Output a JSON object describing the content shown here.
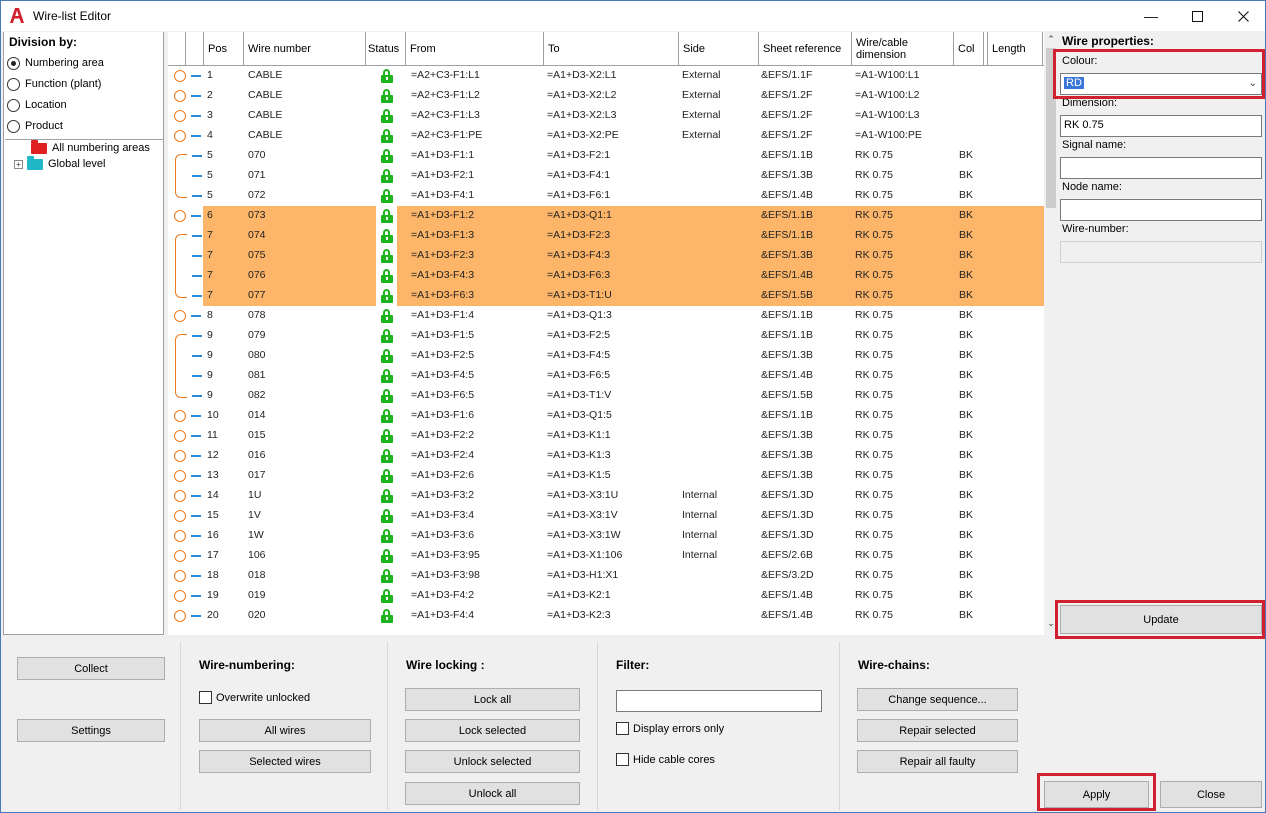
{
  "window": {
    "title": "Wire-list Editor"
  },
  "division": {
    "title": "Division by:",
    "options": [
      "Numbering area",
      "Function (plant)",
      "Location",
      "Product"
    ],
    "selected": 0,
    "tree": [
      {
        "label": "All numbering areas",
        "color": "#e02020"
      },
      {
        "label": "Global level",
        "color": "#20b8c8"
      }
    ]
  },
  "columns": [
    "Pos",
    "Wire number",
    "Status",
    "From",
    "To",
    "Side",
    "Sheet reference",
    "Wire/cable dimension",
    "Col",
    "Length"
  ],
  "rows": [
    {
      "pos": "1",
      "wire": "CABLE",
      "from": "=A2+C3-F1:L1",
      "to": "=A1+D3-X2:L1",
      "side": "External",
      "sheet": "&EFS/1.1F",
      "dim": "=A1-W100:L1",
      "col": "",
      "marker": "circle",
      "sel": false
    },
    {
      "pos": "2",
      "wire": "CABLE",
      "from": "=A2+C3-F1:L2",
      "to": "=A1+D3-X2:L2",
      "side": "External",
      "sheet": "&EFS/1.2F",
      "dim": "=A1-W100:L2",
      "col": "",
      "marker": "circle",
      "sel": false
    },
    {
      "pos": "3",
      "wire": "CABLE",
      "from": "=A2+C3-F1:L3",
      "to": "=A1+D3-X2:L3",
      "side": "External",
      "sheet": "&EFS/1.2F",
      "dim": "=A1-W100:L3",
      "col": "",
      "marker": "circle",
      "sel": false
    },
    {
      "pos": "4",
      "wire": "CABLE",
      "from": "=A2+C3-F1:PE",
      "to": "=A1+D3-X2:PE",
      "side": "External",
      "sheet": "&EFS/1.2F",
      "dim": "=A1-W100:PE",
      "col": "",
      "marker": "circle",
      "sel": false
    },
    {
      "pos": "5",
      "wire": "070",
      "from": "=A1+D3-F1:1",
      "to": "=A1+D3-F2:1",
      "side": "",
      "sheet": "&EFS/1.1B",
      "dim": "RK 0.75",
      "col": "BK",
      "marker": "chain",
      "sel": false
    },
    {
      "pos": "5",
      "wire": "071",
      "from": "=A1+D3-F2:1",
      "to": "=A1+D3-F4:1",
      "side": "",
      "sheet": "&EFS/1.3B",
      "dim": "RK 0.75",
      "col": "BK",
      "marker": "chain",
      "sel": false
    },
    {
      "pos": "5",
      "wire": "072",
      "from": "=A1+D3-F4:1",
      "to": "=A1+D3-F6:1",
      "side": "",
      "sheet": "&EFS/1.4B",
      "dim": "RK 0.75",
      "col": "BK",
      "marker": "chain",
      "sel": false
    },
    {
      "pos": "6",
      "wire": "073",
      "from": "=A1+D3-F1:2",
      "to": "=A1+D3-Q1:1",
      "side": "",
      "sheet": "&EFS/1.1B",
      "dim": "RK 0.75",
      "col": "BK",
      "marker": "circle",
      "sel": true
    },
    {
      "pos": "7",
      "wire": "074",
      "from": "=A1+D3-F1:3",
      "to": "=A1+D3-F2:3",
      "side": "",
      "sheet": "&EFS/1.1B",
      "dim": "RK 0.75",
      "col": "BK",
      "marker": "chain",
      "sel": true
    },
    {
      "pos": "7",
      "wire": "075",
      "from": "=A1+D3-F2:3",
      "to": "=A1+D3-F4:3",
      "side": "",
      "sheet": "&EFS/1.3B",
      "dim": "RK 0.75",
      "col": "BK",
      "marker": "chain",
      "sel": true
    },
    {
      "pos": "7",
      "wire": "076",
      "from": "=A1+D3-F4:3",
      "to": "=A1+D3-F6:3",
      "side": "",
      "sheet": "&EFS/1.4B",
      "dim": "RK 0.75",
      "col": "BK",
      "marker": "chain",
      "sel": true
    },
    {
      "pos": "7",
      "wire": "077",
      "from": "=A1+D3-F6:3",
      "to": "=A1+D3-T1:U",
      "side": "",
      "sheet": "&EFS/1.5B",
      "dim": "RK 0.75",
      "col": "BK",
      "marker": "chain",
      "sel": true
    },
    {
      "pos": "8",
      "wire": "078",
      "from": "=A1+D3-F1:4",
      "to": "=A1+D3-Q1:3",
      "side": "",
      "sheet": "&EFS/1.1B",
      "dim": "RK 0.75",
      "col": "BK",
      "marker": "circle",
      "sel": false
    },
    {
      "pos": "9",
      "wire": "079",
      "from": "=A1+D3-F1:5",
      "to": "=A1+D3-F2:5",
      "side": "",
      "sheet": "&EFS/1.1B",
      "dim": "RK 0.75",
      "col": "BK",
      "marker": "chain",
      "sel": false
    },
    {
      "pos": "9",
      "wire": "080",
      "from": "=A1+D3-F2:5",
      "to": "=A1+D3-F4:5",
      "side": "",
      "sheet": "&EFS/1.3B",
      "dim": "RK 0.75",
      "col": "BK",
      "marker": "chain",
      "sel": false
    },
    {
      "pos": "9",
      "wire": "081",
      "from": "=A1+D3-F4:5",
      "to": "=A1+D3-F6:5",
      "side": "",
      "sheet": "&EFS/1.4B",
      "dim": "RK 0.75",
      "col": "BK",
      "marker": "chain",
      "sel": false
    },
    {
      "pos": "9",
      "wire": "082",
      "from": "=A1+D3-F6:5",
      "to": "=A1+D3-T1:V",
      "side": "",
      "sheet": "&EFS/1.5B",
      "dim": "RK 0.75",
      "col": "BK",
      "marker": "chain",
      "sel": false
    },
    {
      "pos": "10",
      "wire": "014",
      "from": "=A1+D3-F1:6",
      "to": "=A1+D3-Q1:5",
      "side": "",
      "sheet": "&EFS/1.1B",
      "dim": "RK 0.75",
      "col": "BK",
      "marker": "circle",
      "sel": false
    },
    {
      "pos": "11",
      "wire": "015",
      "from": "=A1+D3-F2:2",
      "to": "=A1+D3-K1:1",
      "side": "",
      "sheet": "&EFS/1.3B",
      "dim": "RK 0.75",
      "col": "BK",
      "marker": "circle",
      "sel": false
    },
    {
      "pos": "12",
      "wire": "016",
      "from": "=A1+D3-F2:4",
      "to": "=A1+D3-K1:3",
      "side": "",
      "sheet": "&EFS/1.3B",
      "dim": "RK 0.75",
      "col": "BK",
      "marker": "circle",
      "sel": false
    },
    {
      "pos": "13",
      "wire": "017",
      "from": "=A1+D3-F2:6",
      "to": "=A1+D3-K1:5",
      "side": "",
      "sheet": "&EFS/1.3B",
      "dim": "RK 0.75",
      "col": "BK",
      "marker": "circle",
      "sel": false
    },
    {
      "pos": "14",
      "wire": "1U",
      "from": "=A1+D3-F3:2",
      "to": "=A1+D3-X3:1U",
      "side": "Internal",
      "sheet": "&EFS/1.3D",
      "dim": "RK 0.75",
      "col": "BK",
      "marker": "circle",
      "sel": false
    },
    {
      "pos": "15",
      "wire": "1V",
      "from": "=A1+D3-F3:4",
      "to": "=A1+D3-X3:1V",
      "side": "Internal",
      "sheet": "&EFS/1.3D",
      "dim": "RK 0.75",
      "col": "BK",
      "marker": "circle",
      "sel": false
    },
    {
      "pos": "16",
      "wire": "1W",
      "from": "=A1+D3-F3:6",
      "to": "=A1+D3-X3:1W",
      "side": "Internal",
      "sheet": "&EFS/1.3D",
      "dim": "RK 0.75",
      "col": "BK",
      "marker": "circle",
      "sel": false
    },
    {
      "pos": "17",
      "wire": "106",
      "from": "=A1+D3-F3:95",
      "to": "=A1+D3-X1:106",
      "side": "Internal",
      "sheet": "&EFS/2.6B",
      "dim": "RK 0.75",
      "col": "BK",
      "marker": "circle",
      "sel": false
    },
    {
      "pos": "18",
      "wire": "018",
      "from": "=A1+D3-F3:98",
      "to": "=A1+D3-H1:X1",
      "side": "",
      "sheet": "&EFS/3.2D",
      "dim": "RK 0.75",
      "col": "BK",
      "marker": "circle",
      "sel": false
    },
    {
      "pos": "19",
      "wire": "019",
      "from": "=A1+D3-F4:2",
      "to": "=A1+D3-K2:1",
      "side": "",
      "sheet": "&EFS/1.4B",
      "dim": "RK 0.75",
      "col": "BK",
      "marker": "circle",
      "sel": false
    },
    {
      "pos": "20",
      "wire": "020",
      "from": "=A1+D3-F4:4",
      "to": "=A1+D3-K2:3",
      "side": "",
      "sheet": "&EFS/1.4B",
      "dim": "RK 0.75",
      "col": "BK",
      "marker": "circle",
      "sel": false
    }
  ],
  "properties": {
    "title": "Wire properties:",
    "colour_label": "Colour:",
    "colour_value": "RD",
    "dimension_label": "Dimension:",
    "dimension_value": "RK 0.75",
    "signal_label": "Signal name:",
    "signal_value": "",
    "node_label": "Node name:",
    "node_value": "",
    "wirenumber_label": "Wire-number:",
    "wirenumber_value": "",
    "update_label": "Update"
  },
  "bottom": {
    "collect": "Collect",
    "settings": "Settings",
    "numbering": {
      "title": "Wire-numbering:",
      "overwrite": "Overwrite unlocked",
      "all": "All wires",
      "selected": "Selected wires"
    },
    "locking": {
      "title": "Wire locking :",
      "lock_all": "Lock all",
      "lock_sel": "Lock selected",
      "unlock_sel": "Unlock selected",
      "unlock_all": "Unlock all"
    },
    "filter": {
      "title": "Filter:",
      "value": "",
      "errors": "Display errors only",
      "hide": "Hide cable cores"
    },
    "chains": {
      "title": "Wire-chains:",
      "change": "Change sequence...",
      "repair_sel": "Repair selected",
      "repair_all": "Repair all faulty"
    },
    "apply": "Apply",
    "close": "Close"
  },
  "colors": {
    "selection": "#fdb56a",
    "highlight": "#d1202f",
    "lock": "#1db31d",
    "marker": "#f07a1a"
  }
}
